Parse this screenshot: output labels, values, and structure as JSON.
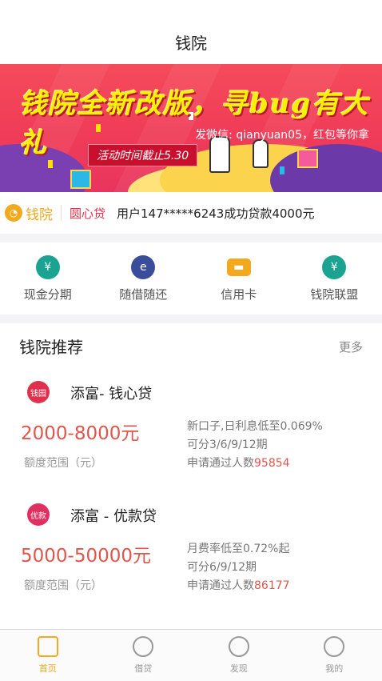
{
  "header": {
    "title": "钱院"
  },
  "banner": {
    "slogan": "钱院全新改版，寻bug有大礼",
    "sub": "发微信: qianyuan05，红包等你拿",
    "deadline": "活动时间截止5.30"
  },
  "ticker": {
    "brand": "钱院",
    "product": "圆心贷",
    "message": "用户147*****6243成功贷款4000元"
  },
  "quick": [
    {
      "label": "现金分期",
      "icon": "yen-cycle-icon",
      "color": "#1aa391",
      "glyph": "¥"
    },
    {
      "label": "随借随还",
      "icon": "e-coin-icon",
      "color": "#3a4d9a",
      "glyph": "e"
    },
    {
      "label": "信用卡",
      "icon": "credit-card-icon",
      "color": "#f2a91e",
      "glyph": "▬"
    },
    {
      "label": "钱院联盟",
      "icon": "user-yen-icon",
      "color": "#1aa391",
      "glyph": "¥"
    }
  ],
  "section": {
    "title": "钱院推荐",
    "more": "更多",
    "products": [
      {
        "logo": "钱园",
        "logo_color": "#e0304d",
        "name": "添富- 钱心贷",
        "range": "2000-8000元",
        "range_label": "额度范围（元）",
        "desc1": "新口子,日利息低至0.069%",
        "desc2": "可分3/6/9/12期",
        "desc3": "申请通过人数",
        "count": "95854"
      },
      {
        "logo": "优款",
        "logo_color": "#e03060",
        "name": "添富 - 优款贷",
        "range": "5000-50000元",
        "range_label": "额度范围（元）",
        "desc1": "月费率低至0.72%起",
        "desc2": "可分6/9/12期",
        "desc3": "申请通过人数",
        "count": "86177"
      }
    ]
  },
  "tabbar": [
    {
      "label": "首页",
      "icon": "home-icon",
      "active": true
    },
    {
      "label": "借贷",
      "icon": "loan-icon",
      "active": false
    },
    {
      "label": "发现",
      "icon": "lightbulb-icon",
      "active": false
    },
    {
      "label": "我的",
      "icon": "user-icon",
      "active": false
    }
  ]
}
